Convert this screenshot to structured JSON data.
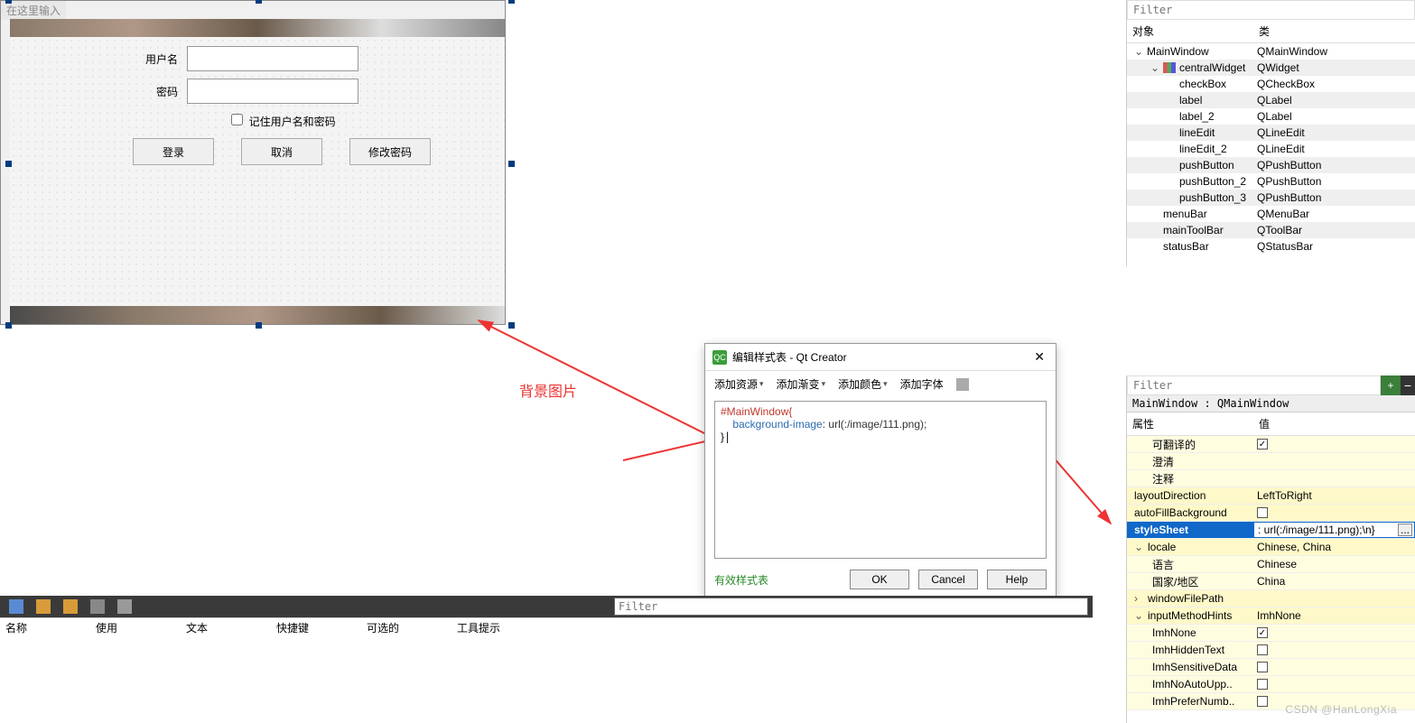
{
  "form": {
    "title_placeholder": "在这里输入",
    "username_label": "用户名",
    "password_label": "密码",
    "remember_label": "记住用户名和密码",
    "login_btn": "登录",
    "cancel_btn": "取消",
    "change_pwd_btn": "修改密码"
  },
  "annotation": {
    "label": "背景图片"
  },
  "dialog": {
    "title": "编辑样式表 - Qt Creator",
    "add_resource": "添加资源",
    "add_gradient": "添加渐变",
    "add_color": "添加颜色",
    "add_font": "添加字体",
    "code_sel": "#MainWindow{",
    "code_prop": "    background-image",
    "code_val": ": url(:/image/111.png);",
    "code_close": "}",
    "valid": "有效样式表",
    "ok": "OK",
    "cancel": "Cancel",
    "help": "Help"
  },
  "tree": {
    "filter_placeholder": "Filter",
    "col_obj": "对象",
    "col_cls": "类",
    "rows": [
      {
        "n": "MainWindow",
        "c": "QMainWindow",
        "d": 0,
        "exp": "v"
      },
      {
        "n": "centralWidget",
        "c": "QWidget",
        "d": 1,
        "exp": "v",
        "ico": true
      },
      {
        "n": "checkBox",
        "c": "QCheckBox",
        "d": 2
      },
      {
        "n": "label",
        "c": "QLabel",
        "d": 2
      },
      {
        "n": "label_2",
        "c": "QLabel",
        "d": 2
      },
      {
        "n": "lineEdit",
        "c": "QLineEdit",
        "d": 2
      },
      {
        "n": "lineEdit_2",
        "c": "QLineEdit",
        "d": 2
      },
      {
        "n": "pushButton",
        "c": "QPushButton",
        "d": 2
      },
      {
        "n": "pushButton_2",
        "c": "QPushButton",
        "d": 2
      },
      {
        "n": "pushButton_3",
        "c": "QPushButton",
        "d": 2
      },
      {
        "n": "menuBar",
        "c": "QMenuBar",
        "d": 1
      },
      {
        "n": "mainToolBar",
        "c": "QToolBar",
        "d": 1
      },
      {
        "n": "statusBar",
        "c": "QStatusBar",
        "d": 1
      }
    ]
  },
  "props": {
    "filter_placeholder": "Filter",
    "path": "MainWindow : QMainWindow",
    "col_name": "属性",
    "col_val": "值",
    "rows": [
      {
        "n": "可翻译的",
        "v": "",
        "chk": true,
        "checked": true,
        "sub": true
      },
      {
        "n": "澄清",
        "v": "",
        "sub": true
      },
      {
        "n": "注释",
        "v": "",
        "sub": true
      },
      {
        "n": "layoutDirection",
        "v": "LeftToRight"
      },
      {
        "n": "autoFillBackground",
        "v": "",
        "chk": true
      },
      {
        "n": "styleSheet",
        "v": ": url(:/image/111.png);\\n}",
        "sel": true,
        "more": true
      },
      {
        "n": "locale",
        "v": "Chinese, China",
        "exp": "v"
      },
      {
        "n": "语言",
        "v": "Chinese",
        "sub": true
      },
      {
        "n": "国家/地区",
        "v": "China",
        "sub": true
      },
      {
        "n": "windowFilePath",
        "v": "",
        "exp": ">"
      },
      {
        "n": "inputMethodHints",
        "v": "ImhNone",
        "exp": "v"
      },
      {
        "n": "ImhNone",
        "v": "",
        "chk": true,
        "checked": true,
        "sub": true
      },
      {
        "n": "ImhHiddenText",
        "v": "",
        "chk": true,
        "sub": true
      },
      {
        "n": "ImhSensitiveData",
        "v": "",
        "chk": true,
        "sub": true
      },
      {
        "n": "ImhNoAutoUpp..",
        "v": "",
        "chk": true,
        "sub": true
      },
      {
        "n": "ImhPreferNumb..",
        "v": "",
        "chk": true,
        "sub": true
      }
    ]
  },
  "bottom": {
    "filter_placeholder": "Filter",
    "cols": [
      "名称",
      "使用",
      "文本",
      "快捷键",
      "可选的",
      "工具提示"
    ]
  },
  "watermark": "CSDN @HanLongXia"
}
